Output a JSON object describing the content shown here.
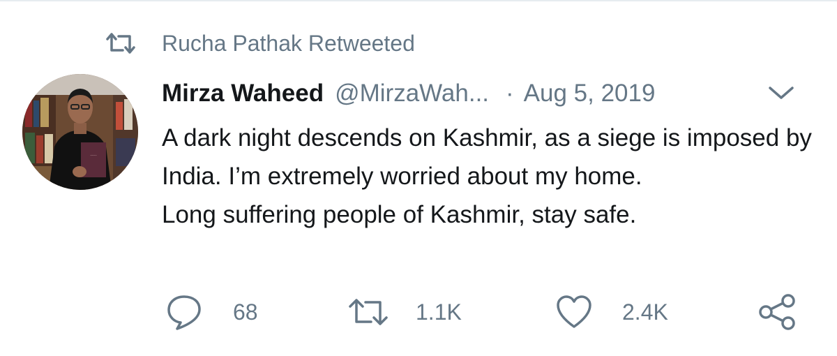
{
  "retweet_context": {
    "text": "Rucha Pathak Retweeted"
  },
  "tweet": {
    "author_name": "Mirza Waheed",
    "handle": "@MirzaWah...",
    "separator": "·",
    "date": "Aug 5, 2019",
    "text_lines": [
      "A dark night descends on Kashmir, as a siege is imposed by India. I’m extremely worried about my home.",
      "Long suffering people of Kashmir, stay safe."
    ]
  },
  "actions": {
    "reply": {
      "icon": "reply-icon",
      "count": "68"
    },
    "retweet": {
      "icon": "retweet-icon",
      "count": "1.1K"
    },
    "like": {
      "icon": "heart-icon",
      "count": "2.4K"
    },
    "share": {
      "icon": "share-icon"
    }
  },
  "colors": {
    "text": "#14171a",
    "secondary": "#657786",
    "divider": "#e6ecf0"
  }
}
